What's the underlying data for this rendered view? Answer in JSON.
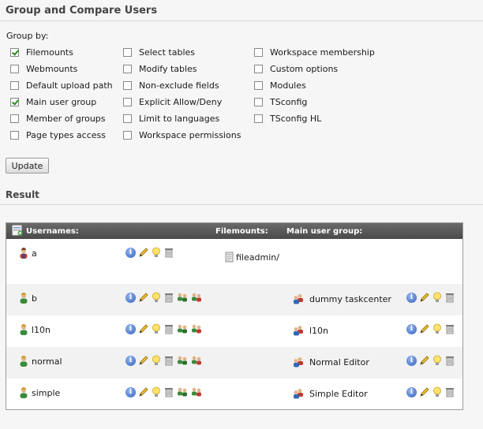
{
  "title": "Group and Compare Users",
  "group_by": {
    "label": "Group by:",
    "options": [
      {
        "label": "Filemounts",
        "checked": true
      },
      {
        "label": "Webmounts",
        "checked": false
      },
      {
        "label": "Default upload path",
        "checked": false
      },
      {
        "label": "Main user group",
        "checked": true
      },
      {
        "label": "Member of groups",
        "checked": false
      },
      {
        "label": "Page types access",
        "checked": false
      },
      {
        "label": "Select tables",
        "checked": false
      },
      {
        "label": "Modify tables",
        "checked": false
      },
      {
        "label": "Non-exclude fields",
        "checked": false
      },
      {
        "label": "Explicit Allow/Deny",
        "checked": false
      },
      {
        "label": "Limit to languages",
        "checked": false
      },
      {
        "label": "Workspace permissions",
        "checked": false
      },
      {
        "label": "Workspace membership",
        "checked": false
      },
      {
        "label": "Custom options",
        "checked": false
      },
      {
        "label": "Modules",
        "checked": false
      },
      {
        "label": "TSconfig",
        "checked": false
      },
      {
        "label": "TSconfig HL",
        "checked": false
      }
    ]
  },
  "update_label": "Update",
  "result_title": "Result",
  "table": {
    "headers": {
      "usernames": "Usernames:",
      "filemounts": "Filemounts:",
      "main_group": "Main user group:"
    },
    "rows": [
      {
        "username": "a",
        "admin": true,
        "filemount": "fileadmin/",
        "main_group": ""
      },
      {
        "username": "b",
        "admin": false,
        "filemount": "",
        "main_group": "dummy taskcenter"
      },
      {
        "username": "l10n",
        "admin": false,
        "filemount": "",
        "main_group": "l10n"
      },
      {
        "username": "normal",
        "admin": false,
        "filemount": "",
        "main_group": "Normal Editor"
      },
      {
        "username": "simple",
        "admin": false,
        "filemount": "",
        "main_group": "Simple Editor"
      }
    ]
  },
  "icons": {
    "info": "info-icon",
    "edit": "pencil-icon",
    "hint": "lightbulb-icon",
    "delete": "trash-icon",
    "switch_user": "switch-user-icon",
    "switch_user_back": "switch-user-back-icon",
    "user": "user-icon",
    "admin_user": "admin-user-icon",
    "group": "group-icon",
    "folder": "filemount-icon",
    "new_record": "new-record-icon"
  },
  "colors": {
    "header_bg": "#5a5a5a",
    "alt_row": "#f2f2f2",
    "check": "#2a8a1f",
    "info": "#2f5fbf"
  }
}
